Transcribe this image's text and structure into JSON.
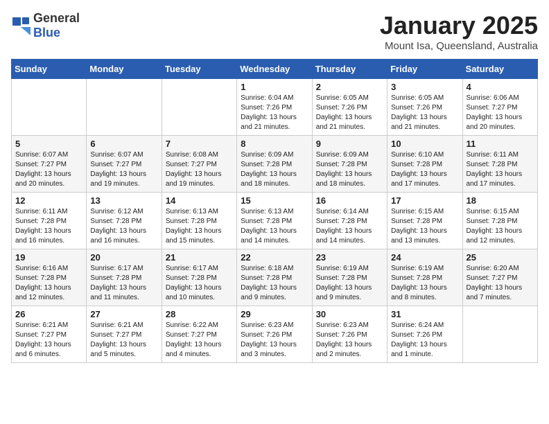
{
  "logo": {
    "general": "General",
    "blue": "Blue"
  },
  "header": {
    "month": "January 2025",
    "location": "Mount Isa, Queensland, Australia"
  },
  "weekdays": [
    "Sunday",
    "Monday",
    "Tuesday",
    "Wednesday",
    "Thursday",
    "Friday",
    "Saturday"
  ],
  "weeks": [
    [
      {
        "day": "",
        "info": ""
      },
      {
        "day": "",
        "info": ""
      },
      {
        "day": "",
        "info": ""
      },
      {
        "day": "1",
        "info": "Sunrise: 6:04 AM\nSunset: 7:26 PM\nDaylight: 13 hours\nand 21 minutes."
      },
      {
        "day": "2",
        "info": "Sunrise: 6:05 AM\nSunset: 7:26 PM\nDaylight: 13 hours\nand 21 minutes."
      },
      {
        "day": "3",
        "info": "Sunrise: 6:05 AM\nSunset: 7:26 PM\nDaylight: 13 hours\nand 21 minutes."
      },
      {
        "day": "4",
        "info": "Sunrise: 6:06 AM\nSunset: 7:27 PM\nDaylight: 13 hours\nand 20 minutes."
      }
    ],
    [
      {
        "day": "5",
        "info": "Sunrise: 6:07 AM\nSunset: 7:27 PM\nDaylight: 13 hours\nand 20 minutes."
      },
      {
        "day": "6",
        "info": "Sunrise: 6:07 AM\nSunset: 7:27 PM\nDaylight: 13 hours\nand 19 minutes."
      },
      {
        "day": "7",
        "info": "Sunrise: 6:08 AM\nSunset: 7:27 PM\nDaylight: 13 hours\nand 19 minutes."
      },
      {
        "day": "8",
        "info": "Sunrise: 6:09 AM\nSunset: 7:28 PM\nDaylight: 13 hours\nand 18 minutes."
      },
      {
        "day": "9",
        "info": "Sunrise: 6:09 AM\nSunset: 7:28 PM\nDaylight: 13 hours\nand 18 minutes."
      },
      {
        "day": "10",
        "info": "Sunrise: 6:10 AM\nSunset: 7:28 PM\nDaylight: 13 hours\nand 17 minutes."
      },
      {
        "day": "11",
        "info": "Sunrise: 6:11 AM\nSunset: 7:28 PM\nDaylight: 13 hours\nand 17 minutes."
      }
    ],
    [
      {
        "day": "12",
        "info": "Sunrise: 6:11 AM\nSunset: 7:28 PM\nDaylight: 13 hours\nand 16 minutes."
      },
      {
        "day": "13",
        "info": "Sunrise: 6:12 AM\nSunset: 7:28 PM\nDaylight: 13 hours\nand 16 minutes."
      },
      {
        "day": "14",
        "info": "Sunrise: 6:13 AM\nSunset: 7:28 PM\nDaylight: 13 hours\nand 15 minutes."
      },
      {
        "day": "15",
        "info": "Sunrise: 6:13 AM\nSunset: 7:28 PM\nDaylight: 13 hours\nand 14 minutes."
      },
      {
        "day": "16",
        "info": "Sunrise: 6:14 AM\nSunset: 7:28 PM\nDaylight: 13 hours\nand 14 minutes."
      },
      {
        "day": "17",
        "info": "Sunrise: 6:15 AM\nSunset: 7:28 PM\nDaylight: 13 hours\nand 13 minutes."
      },
      {
        "day": "18",
        "info": "Sunrise: 6:15 AM\nSunset: 7:28 PM\nDaylight: 13 hours\nand 12 minutes."
      }
    ],
    [
      {
        "day": "19",
        "info": "Sunrise: 6:16 AM\nSunset: 7:28 PM\nDaylight: 13 hours\nand 12 minutes."
      },
      {
        "day": "20",
        "info": "Sunrise: 6:17 AM\nSunset: 7:28 PM\nDaylight: 13 hours\nand 11 minutes."
      },
      {
        "day": "21",
        "info": "Sunrise: 6:17 AM\nSunset: 7:28 PM\nDaylight: 13 hours\nand 10 minutes."
      },
      {
        "day": "22",
        "info": "Sunrise: 6:18 AM\nSunset: 7:28 PM\nDaylight: 13 hours\nand 9 minutes."
      },
      {
        "day": "23",
        "info": "Sunrise: 6:19 AM\nSunset: 7:28 PM\nDaylight: 13 hours\nand 9 minutes."
      },
      {
        "day": "24",
        "info": "Sunrise: 6:19 AM\nSunset: 7:28 PM\nDaylight: 13 hours\nand 8 minutes."
      },
      {
        "day": "25",
        "info": "Sunrise: 6:20 AM\nSunset: 7:27 PM\nDaylight: 13 hours\nand 7 minutes."
      }
    ],
    [
      {
        "day": "26",
        "info": "Sunrise: 6:21 AM\nSunset: 7:27 PM\nDaylight: 13 hours\nand 6 minutes."
      },
      {
        "day": "27",
        "info": "Sunrise: 6:21 AM\nSunset: 7:27 PM\nDaylight: 13 hours\nand 5 minutes."
      },
      {
        "day": "28",
        "info": "Sunrise: 6:22 AM\nSunset: 7:27 PM\nDaylight: 13 hours\nand 4 minutes."
      },
      {
        "day": "29",
        "info": "Sunrise: 6:23 AM\nSunset: 7:26 PM\nDaylight: 13 hours\nand 3 minutes."
      },
      {
        "day": "30",
        "info": "Sunrise: 6:23 AM\nSunset: 7:26 PM\nDaylight: 13 hours\nand 2 minutes."
      },
      {
        "day": "31",
        "info": "Sunrise: 6:24 AM\nSunset: 7:26 PM\nDaylight: 13 hours\nand 1 minute."
      },
      {
        "day": "",
        "info": ""
      }
    ]
  ]
}
